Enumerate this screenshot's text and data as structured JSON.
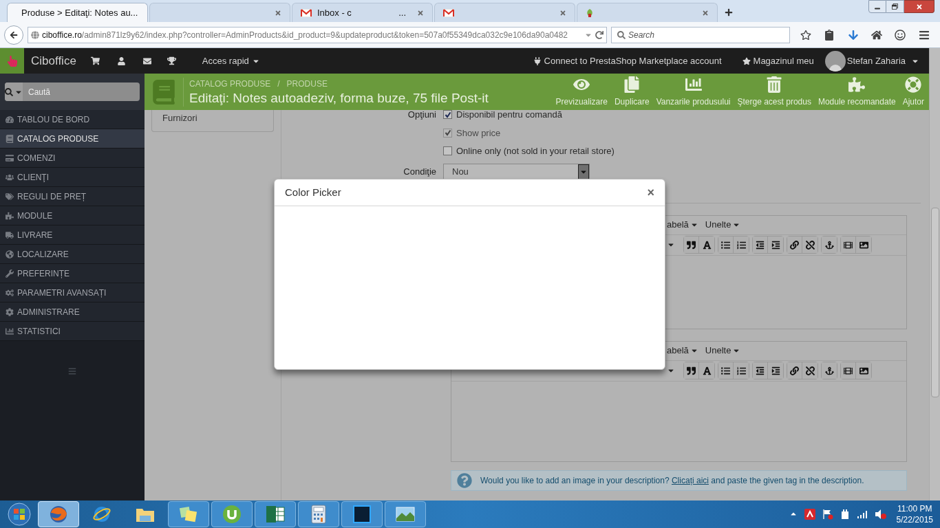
{
  "browser": {
    "tabs": [
      {
        "kind": "prestashop",
        "title": "Produse > Editaţi: Notes au...",
        "selected": true
      },
      {
        "kind": "blank",
        "selected": false
      },
      {
        "kind": "gmail",
        "title": "Inbox - c",
        "title_end": "...",
        "selected": false
      },
      {
        "kind": "gmail",
        "selected": false
      },
      {
        "kind": "leaf",
        "selected": false
      }
    ],
    "address": {
      "host": "ciboffice.ro",
      "path": "/admin871lz9y62/index.php?controller=AdminProducts&id_product=9&updateproduct&token=507a0f55349dca032c9e106da90a0482"
    },
    "search": {
      "placeholder": "Search"
    }
  },
  "admin_header": {
    "brand": "Ciboffice",
    "quick_access": "Acces rapid",
    "marketplace_link": "Connect to PrestaShop Marketplace account",
    "my_shop": "Magazinul meu",
    "user_name": "Stefan Zaharia"
  },
  "sidebar": {
    "search": {
      "placeholder": "Caută"
    },
    "items": [
      {
        "label": "TABLOU DE BORD",
        "selected": false
      },
      {
        "label": "CATALOG PRODUSE",
        "selected": true
      },
      {
        "label": "COMENZI",
        "selected": false
      },
      {
        "label": "CLIENŢI",
        "selected": false
      },
      {
        "label": "REGULI DE PREȚ",
        "selected": false
      },
      {
        "label": "MODULE",
        "selected": false
      },
      {
        "label": "LIVRARE",
        "selected": false
      },
      {
        "label": "LOCALIZARE",
        "selected": false
      },
      {
        "label": "PREFERINȚE",
        "selected": false
      },
      {
        "label": "PARAMETRI AVANSAȚI",
        "selected": false
      },
      {
        "label": "ADMINISTRARE",
        "selected": false
      },
      {
        "label": "STATISTICI",
        "selected": false
      }
    ]
  },
  "toolbar": {
    "breadcrumb": [
      "CATALOG PRODUSE",
      "PRODUSE"
    ],
    "breadcrumb_separator": "/",
    "title": "Editaţi: Notes autoadeziv, forma buze, 75 file Post-it",
    "buttons": [
      "Previzualizare",
      "Duplicare",
      "Vanzarile produsului",
      "Şterge acest produs",
      "Module recomandate",
      "Ajutor"
    ]
  },
  "tab_list": {
    "items": [
      "Furnizori"
    ]
  },
  "form": {
    "options": {
      "label": "Opţiuni",
      "checkboxes": [
        {
          "label": "Disponibil pentru comandă",
          "checked": true,
          "disabled": false
        },
        {
          "label": "Show price",
          "checked": true,
          "disabled": true
        },
        {
          "label": "Online only (not sold in your retail store)",
          "checked": false,
          "disabled": false
        }
      ]
    },
    "condition": {
      "label": "Condiţie",
      "value": "Nou"
    },
    "editors": [
      {
        "menus": [
          "abelă",
          "Unelte"
        ]
      },
      {
        "menus": [
          "abelă",
          "Unelte"
        ]
      }
    ],
    "info": {
      "text": "Would you like to add an image in your description?",
      "link": "Clicați aici",
      "text_end": "and paste the given tag in the description."
    }
  },
  "modal": {
    "title": "Color Picker",
    "close": "×"
  },
  "taskbar": {
    "time": "11:00 PM",
    "date": "5/22/2015"
  }
}
